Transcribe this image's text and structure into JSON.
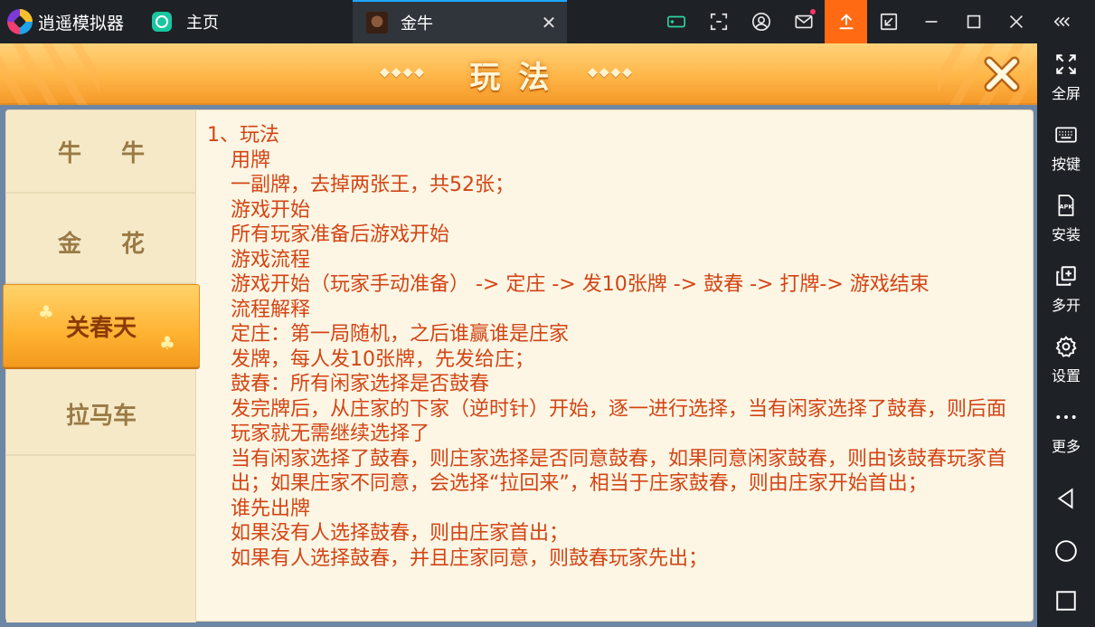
{
  "titlebar": {
    "app_name": "逍遥模拟器",
    "home_tab": "主页",
    "game_tab": "金牛",
    "close_tab": "✕"
  },
  "sidebar": {
    "items": [
      {
        "label": "全屏",
        "icon": "fullscreen-icon"
      },
      {
        "label": "按键",
        "icon": "keyboard-icon"
      },
      {
        "label": "安装",
        "icon": "apk-icon"
      },
      {
        "label": "多开",
        "icon": "multi-instance-icon"
      },
      {
        "label": "设置",
        "icon": "gear-icon"
      },
      {
        "label": "更多",
        "icon": "more-icon"
      }
    ],
    "nav": [
      "back-icon",
      "home-circle-icon",
      "recent-square-icon"
    ]
  },
  "panel": {
    "title": "玩法",
    "diamonds": "◆◆◆◆",
    "tabs": [
      {
        "label": "牛牛"
      },
      {
        "label": "金花"
      },
      {
        "label": "关春天"
      },
      {
        "label": "拉马车"
      }
    ],
    "active_tab": "关春天"
  },
  "content": {
    "lines": [
      "1、玩法",
      "用牌",
      "一副牌，去掉两张王，共52张；",
      "游戏开始",
      "所有玩家准备后游戏开始",
      "游戏流程",
      "游戏开始（玩家手动准备） -> 定庄 -> 发10张牌 -> 鼓春 -> 打牌-> 游戏结束",
      "流程解释",
      "定庄：第一局随机，之后谁赢谁是庄家",
      "发牌，每人发10张牌，先发给庄；",
      "鼓春：所有闲家选择是否鼓春",
      "发完牌后，从庄家的下家（逆时针）开始，逐一进行选择，当有闲家选择了鼓春，则后面玩家就无需继续选择了",
      "当有闲家选择了鼓春，则庄家选择是否同意鼓春，如果同意闲家鼓春，则由该鼓春玩家首出；如果庄家不同意，会选择“拉回来”，相当于庄家鼓春，则由庄家开始首出；",
      "谁先出牌",
      "如果没有人选择鼓春，则由庄家首出；",
      "如果有人选择鼓春，并且庄家同意，则鼓春玩家先出；"
    ]
  },
  "colors": {
    "accent": "#ff6a13",
    "content_text": "#d24516",
    "header_gold": "#ffb648"
  }
}
